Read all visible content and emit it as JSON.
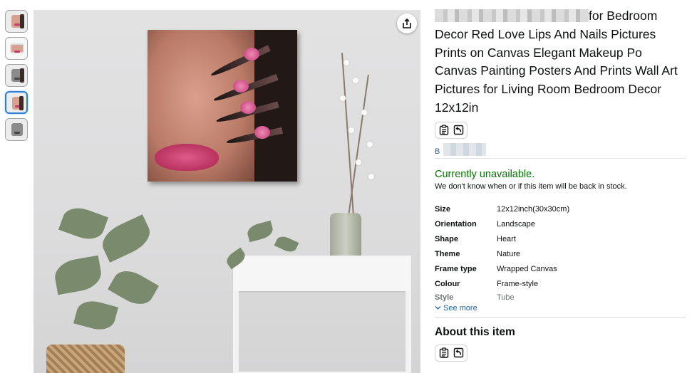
{
  "gallery": {
    "thumbnails": [
      {
        "label": "thumbnail 1",
        "active": false
      },
      {
        "label": "thumbnail 2",
        "active": false
      },
      {
        "label": "thumbnail 3",
        "active": false
      },
      {
        "label": "thumbnail 4",
        "active": true
      },
      {
        "label": "thumbnail 5",
        "active": false
      }
    ]
  },
  "product": {
    "title_visible": "for Bedroom Decor Red Love Lips And Nails Pictures Prints on Canvas Elegant Makeup Po Canvas Painting Posters And Prints Wall Art Pictures for Living Room Bedroom Decor 12x12in",
    "brand_prefix": "B",
    "availability": "Currently unavailable.",
    "stock_note": "We don't know when or if this item will be back in stock.",
    "specs": [
      {
        "key": "Size",
        "value": "12x12inch(30x30cm)"
      },
      {
        "key": "Orientation",
        "value": "Landscape"
      },
      {
        "key": "Shape",
        "value": "Heart"
      },
      {
        "key": "Theme",
        "value": "Nature"
      },
      {
        "key": "Frame type",
        "value": "Wrapped Canvas"
      },
      {
        "key": "Colour",
        "value": "Frame-style"
      },
      {
        "key": "Style",
        "value": "Tube"
      }
    ],
    "see_more": "See more",
    "about_heading": "About this item"
  },
  "icons": {
    "share": "share-icon",
    "clipboard": "clipboard-icon",
    "undo": "undo-icon",
    "chevron": "chevron-down-icon"
  },
  "colors": {
    "available_green": "#007600",
    "link_blue": "#2162a1",
    "active_thumb": "#2a7fd4"
  }
}
